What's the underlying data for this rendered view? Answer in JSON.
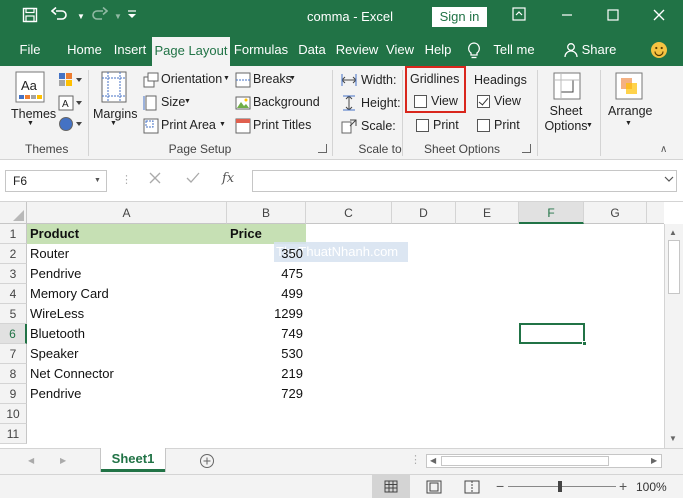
{
  "titlebar": {
    "doc_title": "comma  -  Excel",
    "signin_label": "Sign in"
  },
  "tabs": [
    "File",
    "Home",
    "Insert",
    "Page Layout",
    "Formulas",
    "Data",
    "Review",
    "View",
    "Help"
  ],
  "tell_me": "Tell me",
  "share": "Share",
  "ribbon": {
    "themes": {
      "label": "Themes",
      "group": "Themes"
    },
    "page_setup": {
      "margins": "Margins",
      "orientation": "Orientation",
      "size": "Size",
      "print_area": "Print Area",
      "breaks": "Breaks",
      "background": "Background",
      "print_titles": "Print Titles",
      "group": "Page Setup"
    },
    "scale_to_fit": {
      "width": "Width:",
      "height": "Height:",
      "scale": "Scale:",
      "group": "Scale to"
    },
    "sheet_options": {
      "gridlines": "Gridlines",
      "headings": "Headings",
      "gridlines_view": "View",
      "gridlines_print": "Print",
      "headings_view": "View",
      "headings_print": "Print",
      "gridlines_view_checked": false,
      "gridlines_print_checked": false,
      "headings_view_checked": true,
      "headings_print_checked": false,
      "group": "Sheet Options",
      "sheet_options_btn": "Sheet Options"
    },
    "arrange": "Arrange"
  },
  "formula_bar": {
    "name_box": "F6",
    "fx": "fx",
    "value": ""
  },
  "grid": {
    "columns": [
      "A",
      "B",
      "C",
      "D",
      "E",
      "F",
      "G"
    ],
    "selected_column": "F",
    "rows": [
      "1",
      "2",
      "3",
      "4",
      "5",
      "6",
      "7",
      "8",
      "9",
      "10",
      "11"
    ],
    "selected_row": "6",
    "header": {
      "product": "Product",
      "price": "Price"
    },
    "data": [
      {
        "product": "Router",
        "price": "350"
      },
      {
        "product": "Pendrive",
        "price": "475"
      },
      {
        "product": "Memory Card",
        "price": "499"
      },
      {
        "product": "WireLess",
        "price": "1299"
      },
      {
        "product": "Bluetooth",
        "price": "749"
      },
      {
        "product": "Speaker",
        "price": "530"
      },
      {
        "product": "Net Connector",
        "price": "219"
      },
      {
        "product": "Pendrive",
        "price": "729"
      }
    ],
    "watermark": "ThuThuatNhanh.com",
    "header_fill": "#c6e0b4"
  },
  "sheet_tabs": {
    "active": "Sheet1"
  },
  "status": {
    "zoom": "100%"
  },
  "colors": {
    "accent": "#217346",
    "highlight_box": "#d9261c"
  }
}
